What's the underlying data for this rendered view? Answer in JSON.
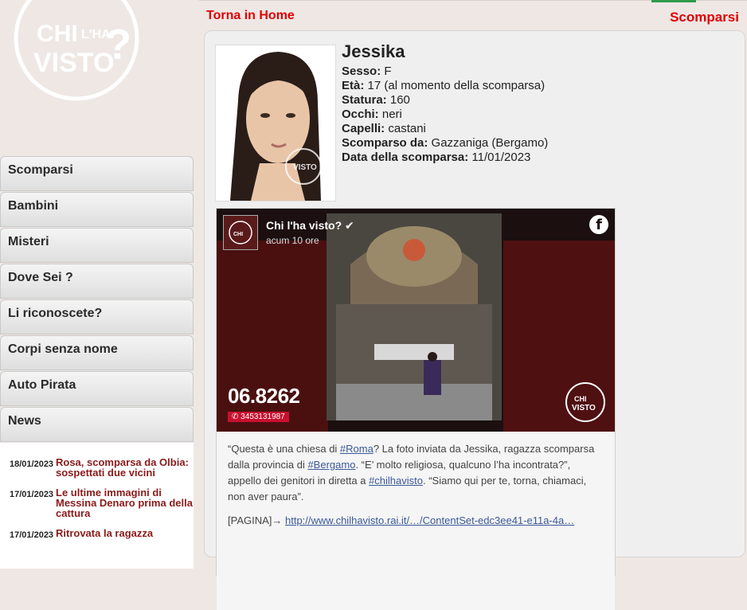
{
  "header": {
    "logo_text": "CHI L'HA VISTO?",
    "home_link": "Torna in Home",
    "section": "Scomparsi"
  },
  "sidebar": {
    "items": [
      {
        "label": "Scomparsi"
      },
      {
        "label": "Bambini"
      },
      {
        "label": "Misteri"
      },
      {
        "label": "Dove Sei ?"
      },
      {
        "label": "Li riconoscete?"
      },
      {
        "label": "Corpi senza nome"
      },
      {
        "label": "Auto Pirata"
      },
      {
        "label": "News"
      }
    ],
    "news": [
      {
        "date": "18/01/2023",
        "title": "Rosa, scomparsa da Olbia: sospettati due vicini"
      },
      {
        "date": "17/01/2023",
        "title": "Le ultime immagini di Messina Denaro prima della cattura"
      },
      {
        "date": "17/01/2023",
        "title": "Ritrovata la ragazza"
      }
    ]
  },
  "person": {
    "name": "Jessika",
    "fields": [
      {
        "label": "Sesso:",
        "value": "F"
      },
      {
        "label": "Età:",
        "value": "17 (al momento della scomparsa)"
      },
      {
        "label": "Statura:",
        "value": "160"
      },
      {
        "label": "Occhi:",
        "value": "neri"
      },
      {
        "label": "Capelli:",
        "value": "castani"
      },
      {
        "label": "Scomparso da:",
        "value": "Gazzaniga (Bergamo)"
      },
      {
        "label": "Data della scomparsa:",
        "value": "11/01/2023"
      }
    ],
    "photo_watermark": "CHI L'HA VISTO?"
  },
  "facebook_post": {
    "page_name": "Chi l'ha visto?",
    "time": "acum 10 ore",
    "phone": "06.8262",
    "whatsapp": "3453131987",
    "text_parts": [
      {
        "t": "“Questa è una chiesa di ",
        "tag": false
      },
      {
        "t": "#Roma",
        "tag": true
      },
      {
        "t": "? La foto inviata da Jessika, ragazza scomparsa dalla provincia di ",
        "tag": false
      },
      {
        "t": "#Bergamo",
        "tag": true
      },
      {
        "t": ". “E’ molto religiosa, qualcuno l’ha incontrata?”, appello dei genitori in diretta a ",
        "tag": false
      },
      {
        "t": "#chilhavisto",
        "tag": true
      },
      {
        "t": ". “Siamo qui per te, torna, chiamaci, non aver paura”.",
        "tag": false
      }
    ],
    "link_prefix": "[PAGINA]→ ",
    "link_text": "http://www.chilhavisto.rai.it/…/ContentSet-edc3ee41-e11a-4a…"
  },
  "colors": {
    "brand_red": "#e00000",
    "news_red": "#8b1a1a",
    "hashtag_blue": "#3b5998"
  }
}
